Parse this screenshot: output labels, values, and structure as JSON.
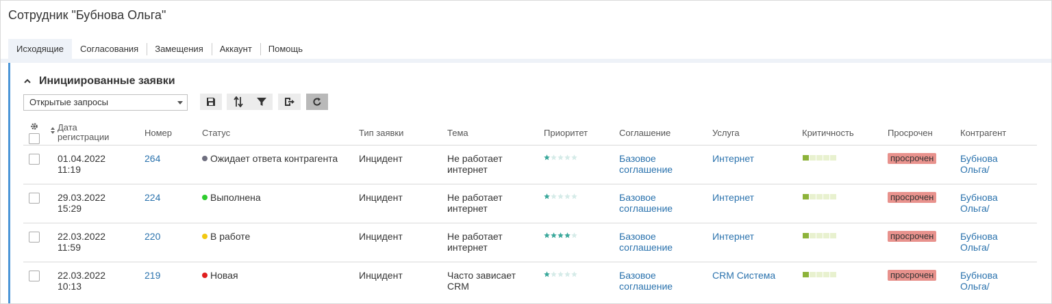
{
  "title": "Сотрудник \"Бубнова Ольга\"",
  "tabs": [
    {
      "label": "Исходящие",
      "active": true
    },
    {
      "label": "Согласования"
    },
    {
      "label": "Замещения"
    },
    {
      "label": "Аккаунт"
    },
    {
      "label": "Помощь"
    }
  ],
  "section": {
    "title": "Инициированные заявки"
  },
  "filter": {
    "selected": "Открытые запросы"
  },
  "toolbar_icons": [
    "save-icon",
    "sort-icon",
    "filter-icon",
    "export-icon",
    "refresh-icon"
  ],
  "columns": {
    "date": "Дата регистрации",
    "number": "Номер",
    "status": "Статус",
    "type": "Тип заявки",
    "topic": "Тема",
    "priority": "Приоритет",
    "agreement": "Соглашение",
    "service": "Услуга",
    "criticality": "Критичность",
    "overdue": "Просрочен",
    "contractor": "Контрагент"
  },
  "colors": {
    "accent": "#4c96d7",
    "link": "#2a72ad",
    "overdue_badge": "#e8928d",
    "star": "#3aa89b"
  },
  "rows": [
    {
      "date": "01.04.2022",
      "time": "11:19",
      "number": "264",
      "status": "Ожидает ответа контрагента",
      "status_color": "#6f6f7f",
      "type": "Инцидент",
      "topic1": "Не работает",
      "topic2": "интернет",
      "priority": 1,
      "agreement1": "Базовое",
      "agreement2": "соглашение",
      "service": "Интернет",
      "criticality": 1,
      "overdue": "просрочен",
      "contractor1": "Бубнова",
      "contractor2": "Ольга/"
    },
    {
      "date": "29.03.2022",
      "time": "15:29",
      "number": "224",
      "status": "Выполнена",
      "status_color": "#2ecc2e",
      "type": "Инцидент",
      "topic1": "Не работает",
      "topic2": "интернет",
      "priority": 1,
      "agreement1": "Базовое",
      "agreement2": "соглашение",
      "service": "Интернет",
      "criticality": 1,
      "overdue": "просрочен",
      "contractor1": "Бубнова",
      "contractor2": "Ольга/"
    },
    {
      "date": "22.03.2022",
      "time": "11:59",
      "number": "220",
      "status": "В работе",
      "status_color": "#f2c811",
      "type": "Инцидент",
      "topic1": "Не работает",
      "topic2": "интернет",
      "priority": 4,
      "agreement1": "Базовое",
      "agreement2": "соглашение",
      "service": "Интернет",
      "criticality": 1,
      "overdue": "просрочен",
      "contractor1": "Бубнова",
      "contractor2": "Ольга/"
    },
    {
      "date": "22.03.2022",
      "time": "10:13",
      "number": "219",
      "status": "Новая",
      "status_color": "#e01e1e",
      "type": "Инцидент",
      "topic1": "Часто зависает",
      "topic2": "CRM",
      "priority": 1,
      "agreement1": "Базовое",
      "agreement2": "соглашение",
      "service": "CRM Система",
      "criticality": 1,
      "overdue": "просрочен",
      "contractor1": "Бубнова",
      "contractor2": "Ольга/"
    }
  ]
}
